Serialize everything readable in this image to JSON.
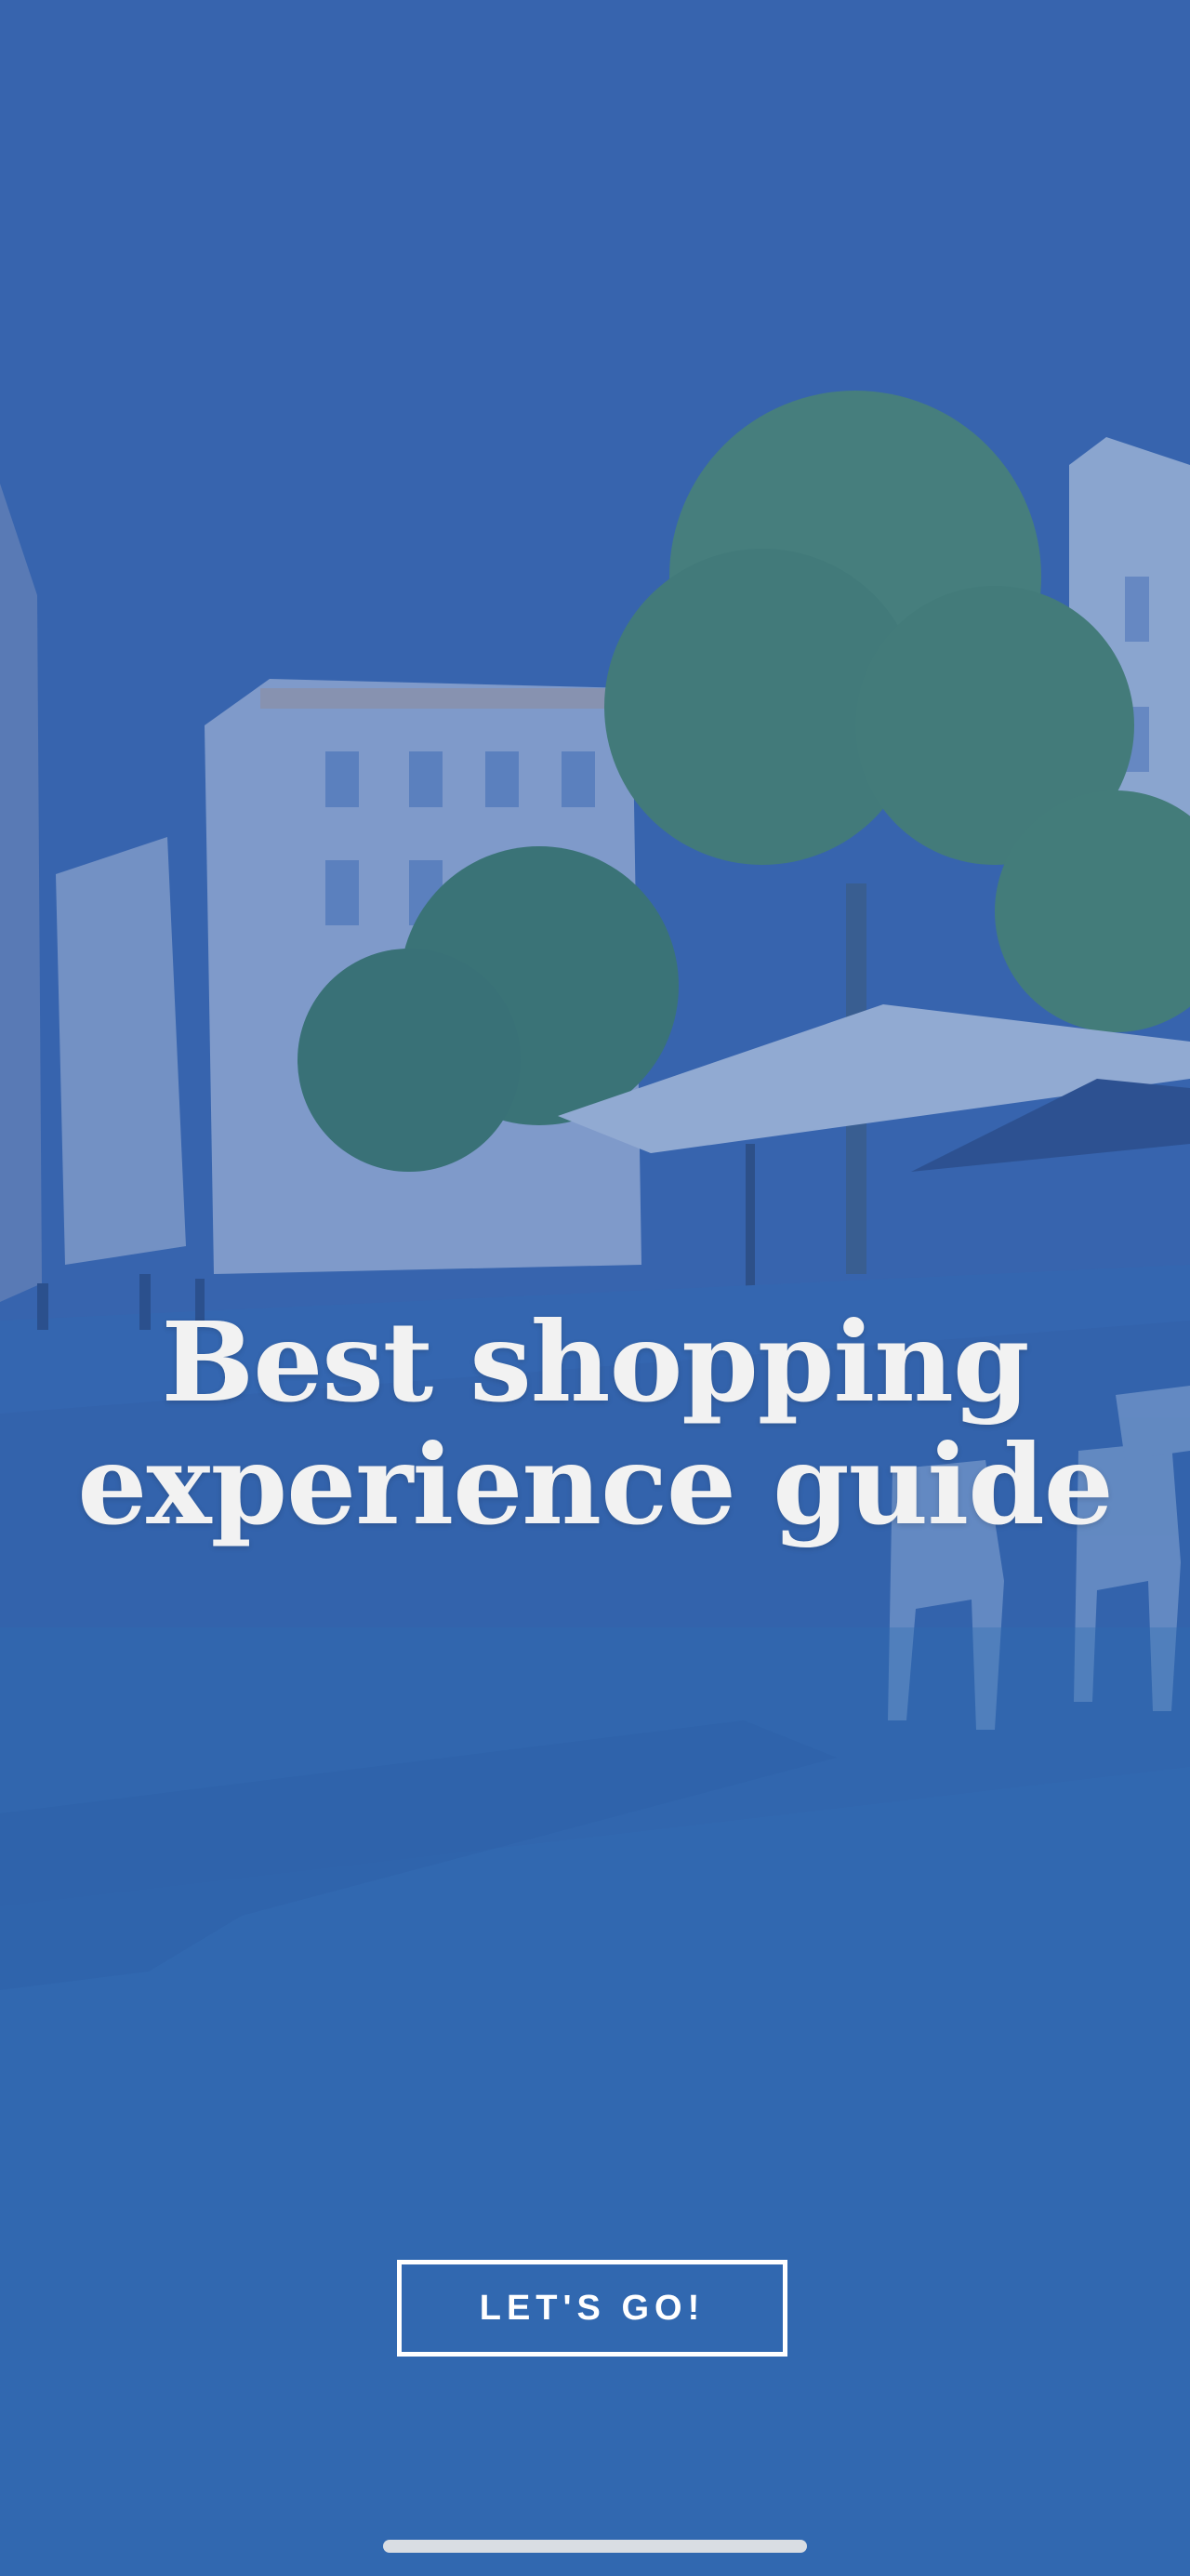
{
  "hero": {
    "headline_line1": "Best shopping",
    "headline_line2": "experience guide",
    "background_photo": "street-cafe-with-trees-and-buildings",
    "overlay_color": "#2f6cb3"
  },
  "cta": {
    "label": "LET'S GO!"
  },
  "colors": {
    "text": "#f2f2f2",
    "button_border": "#ffffff",
    "home_indicator": "#d9dde3"
  }
}
